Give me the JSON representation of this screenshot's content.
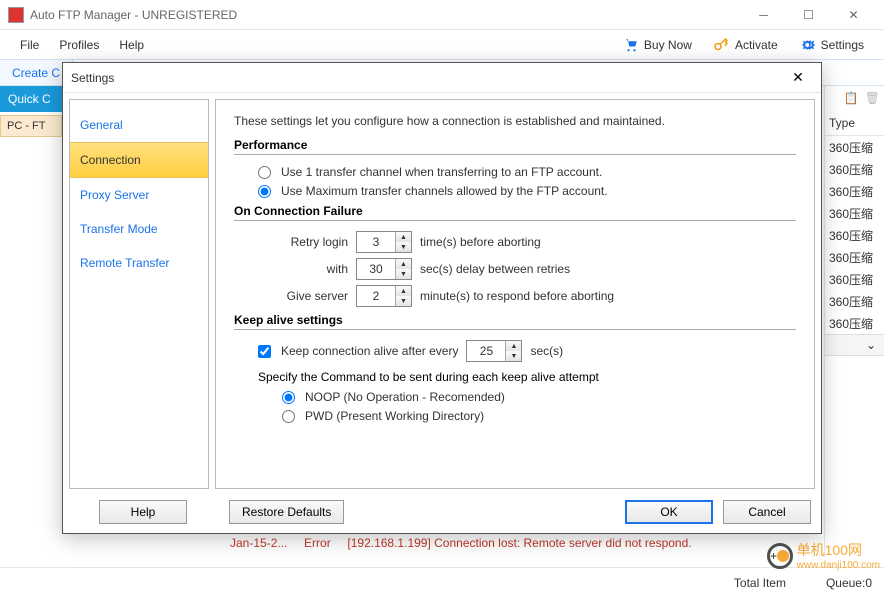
{
  "window": {
    "title": "Auto FTP Manager - UNREGISTERED"
  },
  "menu": {
    "file": "File",
    "profiles": "Profiles",
    "help": "Help",
    "buy_now": "Buy Now",
    "activate": "Activate",
    "settings": "Settings"
  },
  "subbar": {
    "create": "Create C",
    "quick": "Quick C",
    "pcft": "PC - FT"
  },
  "grid": {
    "type_header": "Type",
    "rows": [
      "360压缩",
      "360压缩",
      "360压缩",
      "360压缩",
      "360压缩",
      "360压缩",
      "360压缩",
      "360压缩",
      "360压缩"
    ]
  },
  "status": {
    "total_label": "Total Item",
    "queue_label": "Queue:0"
  },
  "log": {
    "date": "Jan-15-2...",
    "level": "Error",
    "msg": "[192.168.1.199] Connection lost: Remote server did not respond."
  },
  "dialog": {
    "title": "Settings",
    "nav": {
      "general": "General",
      "connection": "Connection",
      "proxy": "Proxy Server",
      "transfer_mode": "Transfer Mode",
      "remote": "Remote Transfer"
    },
    "intro": "These settings let you configure how a connection is established and maintained.",
    "perf_title": "Performance",
    "perf_opt1": "Use 1 transfer channel when transferring to an FTP account.",
    "perf_opt2": "Use Maximum transfer channels allowed by the FTP account.",
    "fail_title": "On Connection Failure",
    "retry_label": "Retry login",
    "retry_value": "3",
    "retry_suffix": "time(s) before aborting",
    "delay_label": "with",
    "delay_value": "30",
    "delay_suffix": "sec(s) delay between retries",
    "respond_label": "Give server",
    "respond_value": "2",
    "respond_suffix": "minute(s) to respond before aborting",
    "keep_title": "Keep alive settings",
    "keep_check": "Keep connection alive after every",
    "keep_value": "25",
    "keep_suffix": "sec(s)",
    "cmd_label": "Specify the Command to be sent during each keep alive attempt",
    "cmd_opt1": "NOOP (No Operation - Recomended)",
    "cmd_opt2": "PWD (Present Working Directory)",
    "footer": {
      "help": "Help",
      "restore": "Restore Defaults",
      "ok": "OK",
      "cancel": "Cancel"
    }
  },
  "watermark": {
    "t1": "单机100网",
    "t2": "www.danji100.com"
  }
}
